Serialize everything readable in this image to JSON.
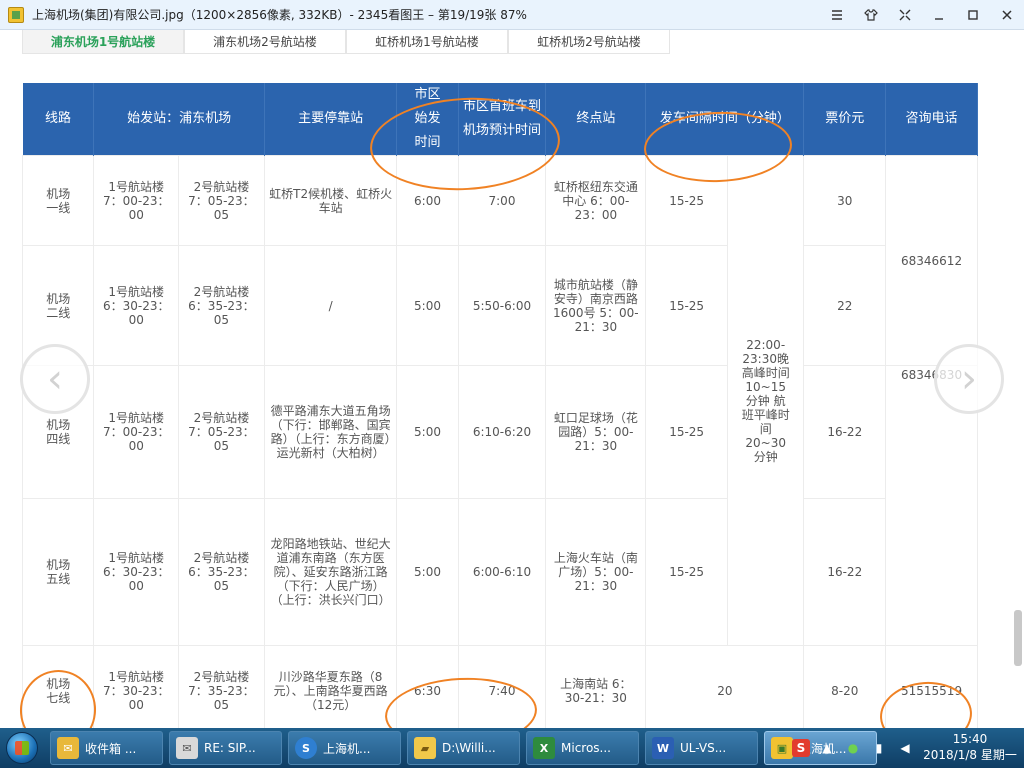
{
  "window": {
    "title": "上海机场(集团)有限公司.jpg（1200×2856像素, 332KB）- 2345看图王 – 第19/19张 87%"
  },
  "tabs": [
    "浦东机场1号航站楼",
    "浦东机场2号航站楼",
    "虹桥机场1号航站楼",
    "虹桥机场2号航站楼"
  ],
  "table": {
    "headers": {
      "route": "线路",
      "origin": "始发站：浦东机场",
      "stops": "主要停靠站",
      "city_first": "市区始发时间",
      "airport_arrival": "市区首班车到机场预计时间",
      "terminal": "终点站",
      "interval": "发车间隔时间（分钟）",
      "fare": "票价元",
      "phone": "咨询电话"
    },
    "rows": [
      {
        "route": "机场一线",
        "t1": "1号航站楼 7：00-23：00",
        "t2": "2号航站楼 7：05-23：05",
        "stops": "虹桥T2候机楼、虹桥火车站",
        "city_first": "6:00",
        "arrival": "7:00",
        "terminal": "虹桥枢纽东交通中心 6：00-23：00",
        "interval": "15-25",
        "fare": "30"
      },
      {
        "route": "机场二线",
        "t1": "1号航站楼 6：30-23：00",
        "t2": "2号航站楼 6：35-23：05",
        "stops": "/",
        "city_first": "5:00",
        "arrival": "5:50-6:00",
        "terminal": "城市航站楼（静安寺）南京西路1600号 5：00-21：30",
        "interval": "15-25",
        "fare": "22"
      },
      {
        "route": "机场四线",
        "t1": "1号航站楼 7：00-23：00",
        "t2": "2号航站楼 7：05-23：05",
        "stops": "德平路浦东大道五角场（下行：邯郸路、国宾路）（上行：东方商厦）运光新村（大柏树）",
        "city_first": "5:00",
        "arrival": "6:10-6:20",
        "terminal": "虹口足球场（花园路）5：00-21：30",
        "interval": "15-25",
        "fare": "16-22"
      },
      {
        "route": "机场五线",
        "t1": "1号航站楼 6：30-23：00",
        "t2": "2号航站楼 6：35-23：05",
        "stops": "龙阳路地铁站、世纪大道浦东南路（东方医院）、延安东路浙江路（下行：人民广场）（上行：洪长兴门口）",
        "city_first": "5:00",
        "arrival": "6:00-6:10",
        "terminal": "上海火车站（南广场）5：00-21：30",
        "interval": "15-25",
        "fare": "16-22"
      },
      {
        "route": "机场七线",
        "t1": "1号航站楼 7：30-23：00",
        "t2": "2号航站楼 7：35-23：05",
        "stops": "川沙路华夏东路（8元）、上南路华夏西路（12元）",
        "city_first": "6:30",
        "arrival": "7:40",
        "terminal": "上海南站 6：30-21：30",
        "interval": "20",
        "fare": "8-20"
      }
    ],
    "merged_interval_note": "22:00-23:30晚高峰时间10~15分钟 航班平峰时间20~30分钟",
    "phone_1": "68346612",
    "phone_2": "68346830",
    "phone_3": "51515519"
  },
  "taskbar": {
    "items": [
      {
        "label": "收件箱 ...",
        "icon": "mail-icon",
        "color": "#e8b83a"
      },
      {
        "label": "RE: SIP...",
        "icon": "envelope-icon",
        "color": "#e8e8e8"
      },
      {
        "label": "上海机...",
        "icon": "sogou-browser-icon",
        "color": "#2f7fd1"
      },
      {
        "label": "D:\\Willi...",
        "icon": "folder-icon",
        "color": "#f1c84a"
      },
      {
        "label": "Micros...",
        "icon": "excel-icon",
        "color": "#2e8b3e"
      },
      {
        "label": "UL-VS...",
        "icon": "word-icon",
        "color": "#2b5fb3"
      },
      {
        "label": "上海机...",
        "icon": "image-viewer-icon",
        "color": "#f1c232"
      }
    ],
    "clock_time": "15:40",
    "clock_date": "2018/1/8 星期一"
  }
}
